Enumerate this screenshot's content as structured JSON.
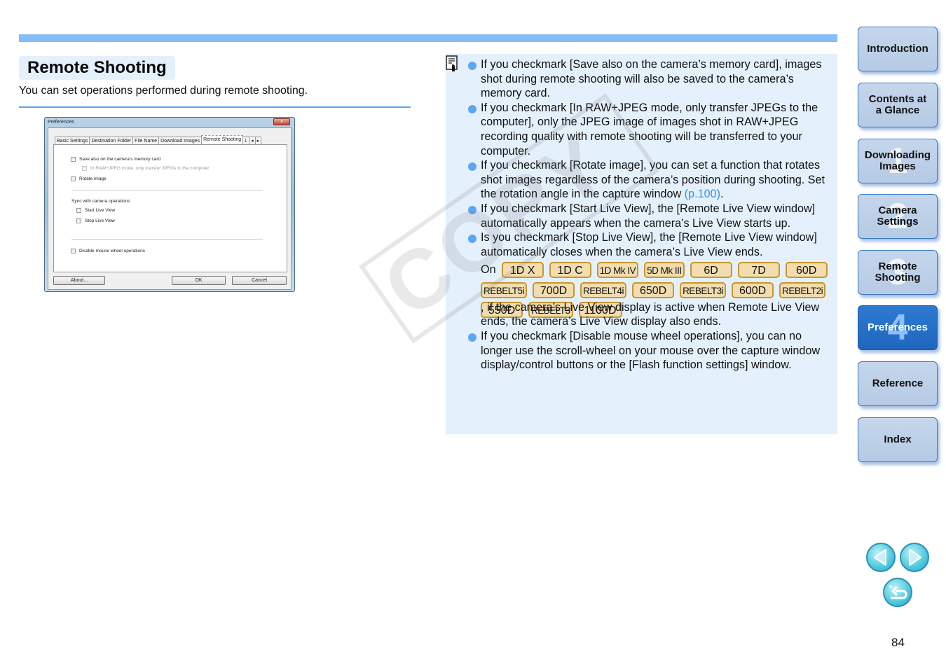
{
  "page": {
    "title": "Remote Shooting",
    "intro": "You can set operations performed during remote shooting.",
    "page_number": "84"
  },
  "dialog": {
    "title": "Preferences",
    "close_label": "x",
    "tabs": [
      "Basic Settings",
      "Destination Folder",
      "File Name",
      "Download Images",
      "Remote Shooting",
      "L"
    ],
    "active_tab": "Remote Shooting",
    "tab_scroll": [
      "◂",
      "▸"
    ],
    "options": {
      "save_on_card": "Save also on the camera's memory card",
      "raw_jpeg_only": "In RAW+JPEG mode, only transfer JPEGs to the computer",
      "rotate_image": "Rotate image",
      "sync_heading": "Sync with camera operations",
      "start_live_view": "Start Live View",
      "stop_live_view": "Stop Live View",
      "disable_mouse_wheel": "Disable mouse wheel operations"
    },
    "buttons": {
      "about": "About...",
      "ok": "OK",
      "cancel": "Cancel"
    }
  },
  "notes": {
    "items": [
      "If you checkmark [Save also on the camera’s memory card], images shot during remote shooting will also be saved to the camera’s memory card.",
      "If you checkmark [In RAW+JPEG mode, only transfer JPEGs to the computer], only the JPEG image of images shot in RAW+JPEG recording quality with remote shooting will be transferred to your computer.",
      "If you checkmark [Rotate image], you can set a function that rotates shot images regardless of the camera’s position during shooting. Set the rotation angle in the capture window ",
      "If you checkmark [Start Live View], the [Remote Live View window] automatically appears when the camera’s Live View starts up.",
      "Is you checkmark [Stop Live View], the [Remote Live View window] automatically closes when the camera’s Live View ends.",
      "If you checkmark [Disable mouse wheel operations], you can no longer use the scroll-wheel on your mouse over the capture window display/control buttons or the [Flash function settings] window."
    ],
    "rotate_link": "(p.100)",
    "rotate_suffix": ".",
    "on_label": "On",
    "models_after": ", if the camera’s Live View display is active when Remote Live View ends, the camera’s Live View display also ends.",
    "models_row1": [
      "1D X",
      "1D C",
      "1D Mk IV",
      "5D Mk III",
      "6D",
      "7D",
      "60D"
    ],
    "models_row2": [
      "REBELT5i",
      "700D",
      "REBELT4i",
      "650D",
      "REBELT3i",
      "600D",
      "REBELT2i"
    ],
    "models_row3": [
      "550D",
      "REBELT3",
      "1100D"
    ]
  },
  "watermark": "COPY",
  "nav": {
    "items": [
      {
        "label": "Introduction",
        "num": ""
      },
      {
        "label": "Contents at a Glance",
        "num": ""
      },
      {
        "label": "Downloading Images",
        "num": "1"
      },
      {
        "label": "Camera Settings",
        "num": "2"
      },
      {
        "label": "Remote Shooting",
        "num": "3"
      },
      {
        "label": "Preferences",
        "num": "4"
      },
      {
        "label": "Reference",
        "num": ""
      },
      {
        "label": "Index",
        "num": ""
      }
    ],
    "active": "Preferences",
    "prev_icon": "triangle-left",
    "next_icon": "triangle-right",
    "return_icon": "return-arrow"
  },
  "colors": {
    "accent": "#85bdf9",
    "panel_bg": "#e4f0fc",
    "bullet": "#5ea6f0",
    "link": "#3a8fe8",
    "chip_border": "#c8962c",
    "chip_bg": "#f2ddb0",
    "nav_active": "#2e7ad0"
  }
}
